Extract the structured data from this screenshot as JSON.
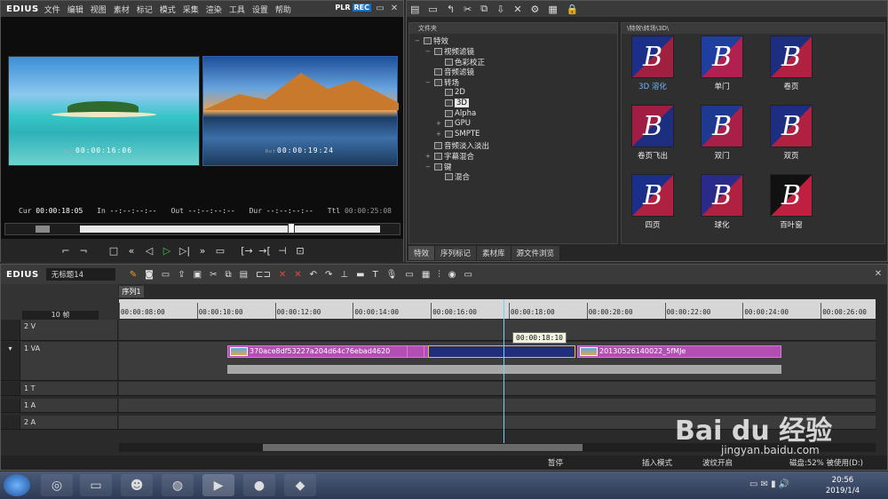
{
  "player": {
    "logo": "EDIUS",
    "menu": [
      "文件",
      "编辑",
      "视图",
      "素材",
      "标记",
      "模式",
      "采集",
      "渲染",
      "工具",
      "设置",
      "帮助"
    ],
    "plr": "PLR",
    "rec": "REC",
    "left_tc": "00:00:16:06",
    "right_tc": "00:00:19:24",
    "tc_prefix": "Rot",
    "cur_label": "Cur",
    "cur": "00:00:18:05",
    "in_label": "In",
    "in": "--:--:--:--",
    "out_label": "Out",
    "out": "--:--:--:--",
    "dur_label": "Dur",
    "dur": "--:--:--:--",
    "ttl_label": "Ttl",
    "ttl": "00:00:25:08"
  },
  "bin": {
    "tree_header": "文件夹",
    "path": "\\特效\\转场\\3D\\",
    "tree": [
      {
        "label": "特效",
        "lvl": 0,
        "exp": "−"
      },
      {
        "label": "视频滤镜",
        "lvl": 1,
        "exp": "−"
      },
      {
        "label": "色彩校正",
        "lvl": 2,
        "exp": ""
      },
      {
        "label": "音频滤镜",
        "lvl": 1,
        "exp": ""
      },
      {
        "label": "转场",
        "lvl": 1,
        "exp": "−"
      },
      {
        "label": "2D",
        "lvl": 2,
        "exp": ""
      },
      {
        "label": "3D",
        "lvl": 2,
        "exp": "",
        "sel": true
      },
      {
        "label": "Alpha",
        "lvl": 2,
        "exp": ""
      },
      {
        "label": "GPU",
        "lvl": 2,
        "exp": "+"
      },
      {
        "label": "SMPTE",
        "lvl": 2,
        "exp": "+"
      },
      {
        "label": "音频淡入淡出",
        "lvl": 1,
        "exp": ""
      },
      {
        "label": "字幕混合",
        "lvl": 1,
        "exp": "+"
      },
      {
        "label": "键",
        "lvl": 1,
        "exp": "−"
      },
      {
        "label": "混合",
        "lvl": 2,
        "exp": ""
      }
    ],
    "effects": [
      {
        "label": "3D 溶化",
        "sel": true,
        "bg": "#1b2f8a",
        "fg": "#a02040"
      },
      {
        "label": "单门",
        "bg": "#1f3fa0",
        "fg": "#b02050"
      },
      {
        "label": "卷页",
        "bg": "#1d2d80",
        "fg": "#b02040"
      },
      {
        "label": "卷页飞出",
        "bg": "#a01e44",
        "fg": "#1d2d80"
      },
      {
        "label": "双门",
        "bg": "#1e3a90",
        "fg": "#a82048"
      },
      {
        "label": "双页",
        "bg": "#1d2d80",
        "fg": "#b02040"
      },
      {
        "label": "四页",
        "bg": "#1b2f8a",
        "fg": "#b02040"
      },
      {
        "label": "球化",
        "bg": "#2a2a8a",
        "fg": "#b02040"
      },
      {
        "label": "百叶窗",
        "bg": "#111",
        "fg": "#c02040"
      }
    ],
    "tabs": [
      "特效",
      "序列标记",
      "素材库",
      "源文件浏览"
    ]
  },
  "timeline": {
    "logo": "EDIUS",
    "seq_name": "无标题14",
    "seq_tab": "序列1",
    "zoom": "10 帧",
    "ruler": [
      "00:00:08:00",
      "00:00:10:00",
      "00:00:12:00",
      "00:00:14:00",
      "00:00:16:00",
      "00:00:18:00",
      "00:00:20:00",
      "00:00:22:00",
      "00:00:24:00",
      "00:00:26:00"
    ],
    "tooltip": "00:00:18:10",
    "tracks": [
      {
        "name": "2 V"
      },
      {
        "name": "1 VA"
      },
      {
        "name": "1 T"
      },
      {
        "name": "1 A"
      },
      {
        "name": "2 A"
      }
    ],
    "clip1": "370ace8df53227a204d64c76ebad4620",
    "clip2": "20130526140022_5fMJe",
    "status": {
      "pause": "暂停",
      "insert": "插入模式",
      "ripple": "波纹开启",
      "disk": "磁盘:52% 被使用(D:)"
    }
  },
  "taskbar": {
    "time": "20:56",
    "date": "2019/1/4"
  },
  "watermark": {
    "brand": "Bai du 经验",
    "url": "jingyan.baidu.com"
  }
}
